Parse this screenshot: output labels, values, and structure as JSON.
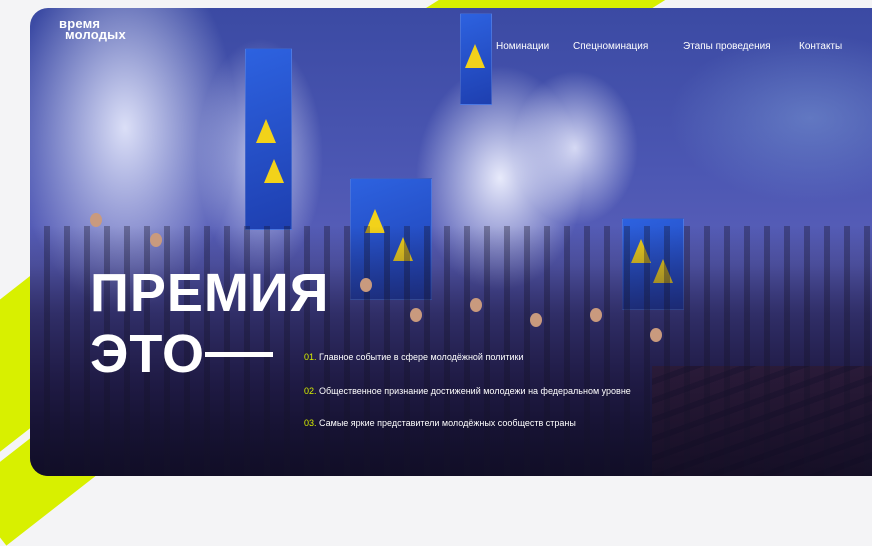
{
  "brand": {
    "logo_line1": "время",
    "logo_line2": "молодых",
    "accent_color": "#d8f000"
  },
  "nav": {
    "items": [
      "Номинации",
      "Спецноминация",
      "Этапы проведения",
      "Контакты"
    ]
  },
  "hero": {
    "title_line1": "ПРЕМИЯ",
    "title_line2": "ЭТО",
    "points": [
      {
        "num": "01.",
        "text": "Главное событие в сфере молодёжной политики"
      },
      {
        "num": "02.",
        "text": "Общественное признание достижений молодежи на федеральном уровне"
      },
      {
        "num": "03.",
        "text": "Самые яркие представители молодёжных сообществ страны"
      }
    ]
  }
}
